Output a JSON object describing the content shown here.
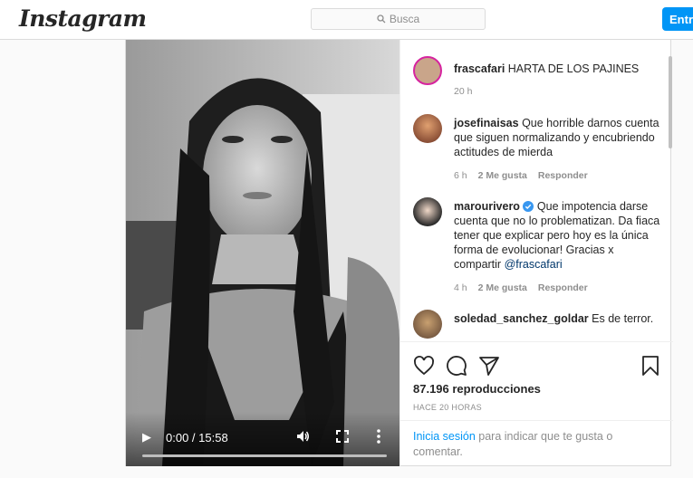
{
  "header": {
    "logo_text": "Instagram",
    "search_placeholder": "Busca",
    "login_button": "Entra"
  },
  "video": {
    "time": "0:00 / 15:58",
    "progress": 0
  },
  "comments": [
    {
      "user": "frascafari",
      "text": "HARTA DE LOS PAJINES",
      "time": "20 h",
      "likes": "",
      "reply": ""
    },
    {
      "user": "josefinaisas",
      "text": "Que horrible darnos cuenta que siguen normalizando y encubriendo actitudes de mierda",
      "time": "6 h",
      "likes": "2 Me gusta",
      "reply": "Responder"
    },
    {
      "user": "marourivero",
      "text": "Que impotencia darse cuenta que no lo problematizan. Da fiaca tener que explicar pero hoy es la única forma de evolucionar! Gracias x compartir",
      "mention": "@frascafari",
      "time": "4 h",
      "likes": "2 Me gusta",
      "reply": "Responder",
      "verified": true
    },
    {
      "user": "soledad_sanchez_goldar",
      "text": "Es de terror.",
      "time": "",
      "likes": "",
      "reply": ""
    }
  ],
  "footer": {
    "views": "87.196 reproducciones",
    "ago": "HACE 20 HORAS",
    "login_link": "Inicia sesión",
    "login_rest": " para indicar que te gusta o comentar."
  },
  "icons": [
    "search-icon",
    "play-icon",
    "volume-icon",
    "fullscreen-icon",
    "more-icon",
    "heart-icon",
    "comment-icon",
    "share-icon",
    "bookmark-icon",
    "verified-icon"
  ],
  "colors": {
    "accent": "#0095f6",
    "mention": "#00376b",
    "muted": "#8e8e8e"
  }
}
